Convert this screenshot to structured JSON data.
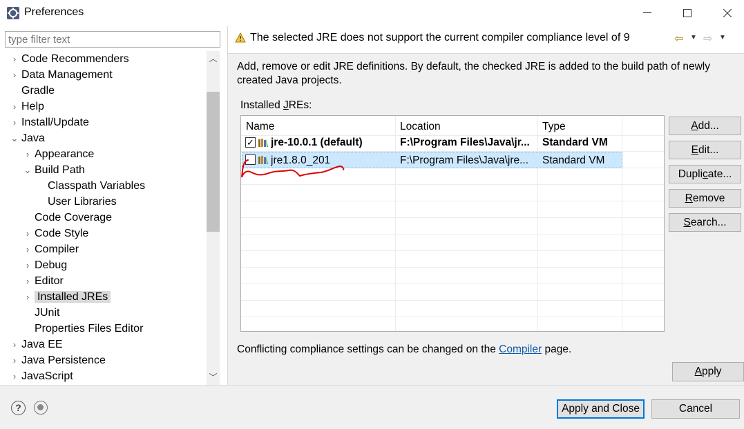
{
  "window": {
    "title": "Preferences",
    "minimize": "—",
    "maximize": "☐",
    "close": "✕"
  },
  "filter": {
    "placeholder": "type filter text",
    "value": ""
  },
  "tree": [
    {
      "label": "Code Recommenders",
      "level": 0,
      "toggle": "›"
    },
    {
      "label": "Data Management",
      "level": 0,
      "toggle": "›"
    },
    {
      "label": "Gradle",
      "level": 0,
      "toggle": ""
    },
    {
      "label": "Help",
      "level": 0,
      "toggle": "›"
    },
    {
      "label": "Install/Update",
      "level": 0,
      "toggle": "›"
    },
    {
      "label": "Java",
      "level": 0,
      "toggle": "⌄"
    },
    {
      "label": "Appearance",
      "level": 1,
      "toggle": "›"
    },
    {
      "label": "Build Path",
      "level": 1,
      "toggle": "⌄"
    },
    {
      "label": "Classpath Variables",
      "level": 2,
      "toggle": ""
    },
    {
      "label": "User Libraries",
      "level": 2,
      "toggle": ""
    },
    {
      "label": "Code Coverage",
      "level": 1,
      "toggle": ""
    },
    {
      "label": "Code Style",
      "level": 1,
      "toggle": "›"
    },
    {
      "label": "Compiler",
      "level": 1,
      "toggle": "›"
    },
    {
      "label": "Debug",
      "level": 1,
      "toggle": "›"
    },
    {
      "label": "Editor",
      "level": 1,
      "toggle": "›"
    },
    {
      "label": "Installed JREs",
      "level": 1,
      "toggle": "›",
      "selected": true
    },
    {
      "label": "JUnit",
      "level": 1,
      "toggle": ""
    },
    {
      "label": "Properties Files Editor",
      "level": 1,
      "toggle": ""
    },
    {
      "label": "Java EE",
      "level": 0,
      "toggle": "›"
    },
    {
      "label": "Java Persistence",
      "level": 0,
      "toggle": "›"
    },
    {
      "label": "JavaScript",
      "level": 0,
      "toggle": "›"
    }
  ],
  "message": {
    "text": "The selected JRE does not support the current compiler compliance level of 9",
    "back_icon": "⇦",
    "forward_icon": "⇨",
    "dropdown_icon": "▼"
  },
  "description": "Add, remove or edit JRE definitions. By default, the checked JRE is added to the build path of newly created Java projects.",
  "installed_label_pre": "Installed ",
  "installed_label_ul": "J",
  "installed_label_post": "REs:",
  "table": {
    "headers": [
      "Name",
      "Location",
      "Type"
    ],
    "rows": [
      {
        "checked": true,
        "name": "jre-10.0.1 (default)",
        "location": "F:\\Program Files\\Java\\jr...",
        "type": "Standard VM",
        "bold": true
      },
      {
        "checked": false,
        "name": "jre1.8.0_201",
        "location": "F:\\Program Files\\Java\\jre...",
        "type": "Standard VM",
        "selected": true
      }
    ]
  },
  "side_buttons": [
    {
      "pre": "",
      "ul": "A",
      "post": "dd..."
    },
    {
      "pre": "",
      "ul": "E",
      "post": "dit..."
    },
    {
      "pre": "Dupli",
      "ul": "c",
      "post": "ate..."
    },
    {
      "pre": "",
      "ul": "R",
      "post": "emove"
    },
    {
      "pre": "",
      "ul": "S",
      "post": "earch..."
    }
  ],
  "footer_note": {
    "pre": "Conflicting compliance settings can be changed on the ",
    "link": "Compiler",
    "post": " page."
  },
  "apply": {
    "ul": "A",
    "post": "pply"
  },
  "apply_and_close": "Apply and Close",
  "cancel": "Cancel",
  "help_icon": "?",
  "accent_color": "#0078d7",
  "selection_color": "#cce8ff",
  "annotation_color": "#e00000"
}
